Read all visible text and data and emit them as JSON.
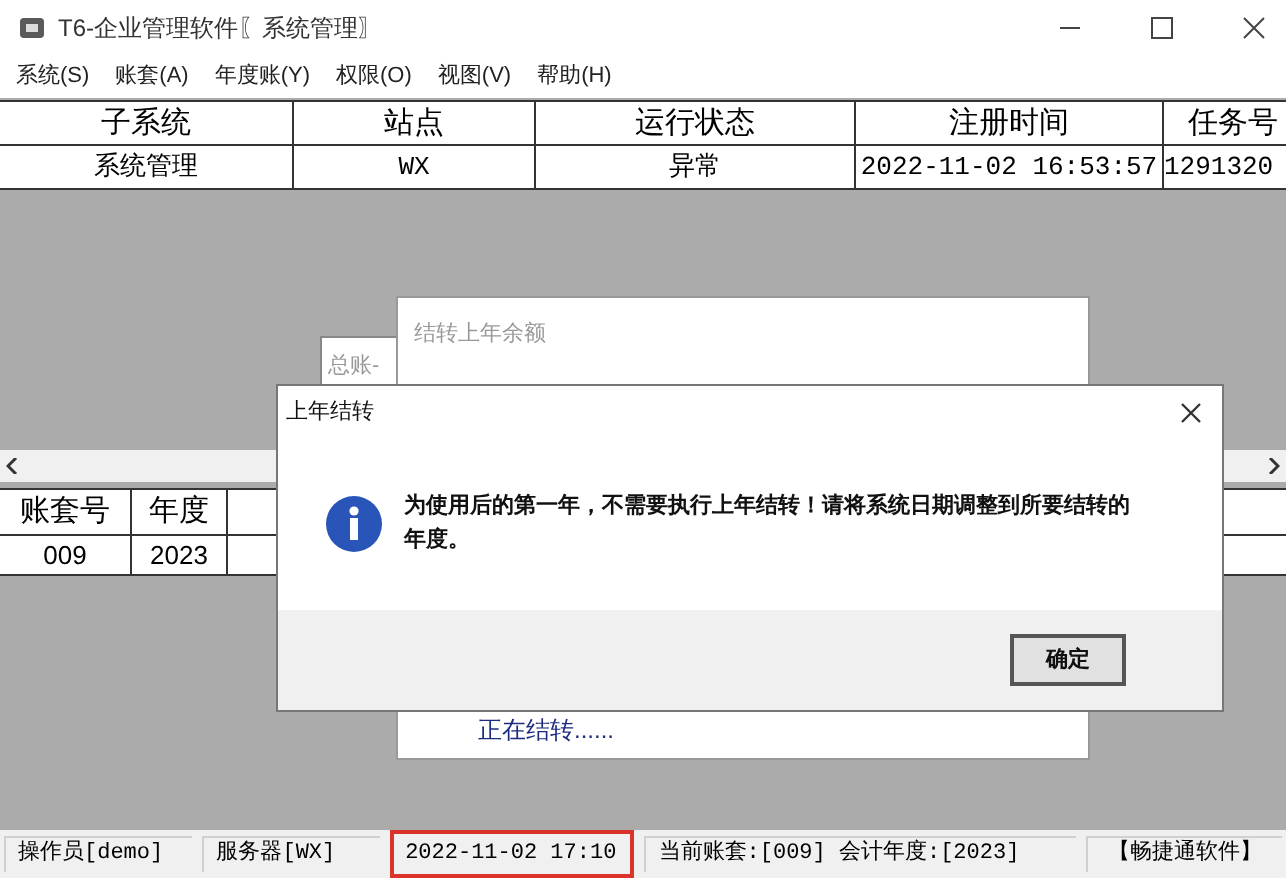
{
  "window": {
    "title": "T6-企业管理软件〖系统管理〗"
  },
  "menu": [
    "系统(S)",
    "账套(A)",
    "年度账(Y)",
    "权限(O)",
    "视图(V)",
    "帮助(H)"
  ],
  "top_table": {
    "columns": [
      "子系统",
      "站点",
      "运行状态",
      "注册时间",
      "任务号"
    ],
    "rows": [
      [
        "系统管理",
        "WX",
        "异常",
        "2022-11-02 16:53:57",
        "1291320"
      ]
    ]
  },
  "bottom_table": {
    "columns": [
      "账套号",
      "年度"
    ],
    "rows": [
      [
        "009",
        "2023"
      ]
    ]
  },
  "back_window": {
    "title": "结转上年余额",
    "status": "正在结转......"
  },
  "back_window_2": {
    "title": "总账-"
  },
  "dialog": {
    "title": "上年结转",
    "message": "为使用后的第一年，不需要执行上年结转！请将系统日期调整到所要结转的年度。",
    "button": "确定"
  },
  "status_bar": [
    {
      "text": "操作员[demo]",
      "highlighted": false
    },
    {
      "text": "服务器[WX]",
      "highlighted": false
    },
    {
      "text": "2022-11-02 17:10",
      "highlighted": true
    },
    {
      "text": "当前账套:[009] 会计年度:[2023]",
      "highlighted": false
    },
    {
      "text": "【畅捷通软件】",
      "highlighted": false
    }
  ]
}
